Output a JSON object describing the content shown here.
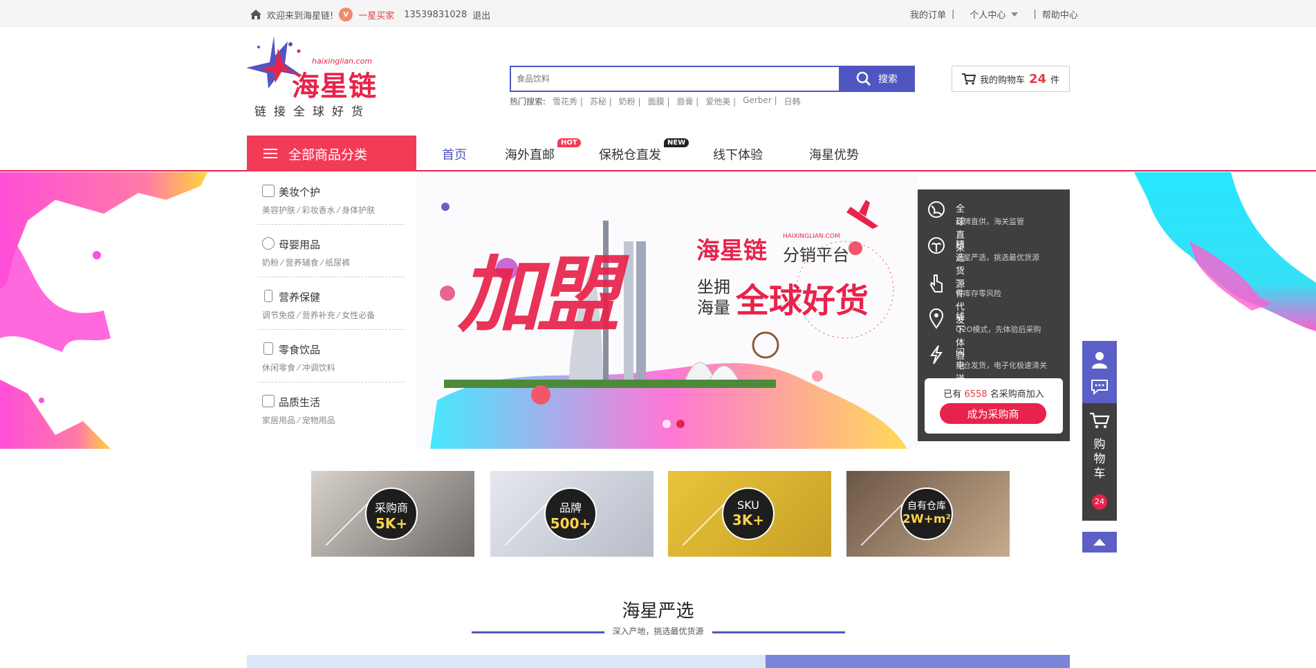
{
  "topbar": {
    "welcome": "欢迎来到海星链!",
    "user_level": "一星买家",
    "phone": "13539831028",
    "logout": "退出",
    "my_orders": "我的订单",
    "personal_center": "个人中心",
    "help_center": "帮助中心",
    "divider": "|"
  },
  "logo": {
    "name": "海星链",
    "domain": "haixinglian.com",
    "slogan": "链接全球好货"
  },
  "search": {
    "placeholder": "食品饮料",
    "button": "搜索",
    "hot_label": "热门搜索:",
    "hot_terms": [
      "雪花秀 |",
      "苏秘 |",
      "奶粉 |",
      "面膜 |",
      "唇膏 |",
      "爱他美 |",
      "Gerber |",
      "日韩"
    ]
  },
  "cart": {
    "label": "我的购物车",
    "count": "24",
    "unit": "件"
  },
  "nav": {
    "all_categories": "全部商品分类",
    "items": [
      "首页",
      "海外直邮",
      "保税仓直发",
      "线下体验",
      "海星优势"
    ],
    "hot_tag": "HOT",
    "new_tag": "NEW"
  },
  "categories": [
    {
      "title": "美妆个护",
      "sub": "美容护肤 ⁄ 彩妆香水 ⁄ 身体护肤"
    },
    {
      "title": "母婴用品",
      "sub": "奶粉 ⁄ 营养辅食 ⁄ 纸尿裤"
    },
    {
      "title": "营养保健",
      "sub": "调节免疫 ⁄ 营养补充 ⁄ 女性必备"
    },
    {
      "title": "零食饮品",
      "sub": "休闲零食 ⁄ 冲调饮料"
    },
    {
      "title": "品质生活",
      "sub": "家居用品 ⁄ 宠物用品"
    }
  ],
  "banner": {
    "big": "加盟",
    "brand": "海星链",
    "brand_en": "HAIXINGLIAN.COM",
    "platform": "分销平台",
    "line1": "坐拥",
    "line2": "海量",
    "slogan": "全球好货"
  },
  "advantages": [
    {
      "title": "全球直采",
      "desc": "品牌直供，海关监管"
    },
    {
      "title": "精选货源",
      "desc": "海星严选，挑选最优货源"
    },
    {
      "title": "一件代发",
      "desc": "零库存零风险"
    },
    {
      "title": "线下体验",
      "desc": "O2O模式，先体验后采购"
    },
    {
      "title": "闪电送达",
      "desc": "多仓发货，电子化极速清关"
    }
  ],
  "join": {
    "prefix": "已有",
    "count": "6558",
    "suffix": "名采购商加入",
    "button": "成为采购商"
  },
  "stats": [
    {
      "label": "采购商",
      "value": "5K+"
    },
    {
      "label": "品牌",
      "value": "500+"
    },
    {
      "label": "SKU",
      "value": "3K+"
    },
    {
      "label": "自有仓库",
      "value": "2W+m²"
    }
  ],
  "section": {
    "title": "海星严选",
    "subtitle": "深入产地，挑选最优货源"
  },
  "sidebar": {
    "cart_label": "购物车",
    "cart_count": "24"
  },
  "colors": {
    "brand_red": "#e8234b",
    "brand_blue": "#5056c1",
    "dark_panel": "#3f3f3f"
  }
}
